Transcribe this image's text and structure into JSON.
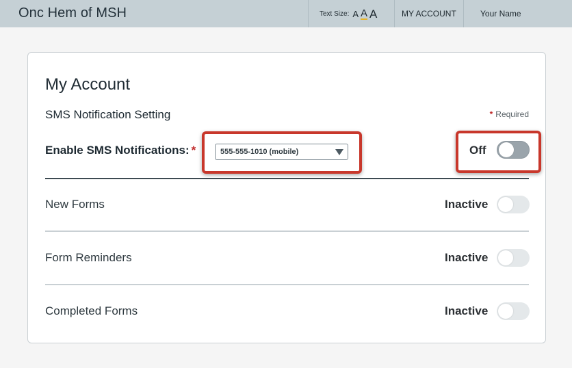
{
  "header": {
    "brand": "Onc Hem of MSH",
    "text_size_label": "Text Size:",
    "text_size_options": [
      "A",
      "A",
      "A"
    ],
    "my_account_link": "MY ACCOUNT",
    "user_name": "Your Name",
    "accent_color": "#e7b52a"
  },
  "page": {
    "title": "My Account",
    "section_title": "SMS Notification Setting",
    "required_star": "*",
    "required_note": "Required"
  },
  "sms": {
    "label": "Enable SMS Notifications:",
    "required_star": "*",
    "selected_phone": "555-555-1010 (mobile)",
    "state_label": "Off",
    "enabled": false
  },
  "notifications": [
    {
      "label": "New Forms",
      "status": "Inactive",
      "enabled": false
    },
    {
      "label": "Form Reminders",
      "status": "Inactive",
      "enabled": false
    },
    {
      "label": "Completed Forms",
      "status": "Inactive",
      "enabled": false
    }
  ],
  "colors": {
    "highlight": "#c8372b",
    "header_bg": "#c5d0d5",
    "required": "#c02a2a"
  }
}
